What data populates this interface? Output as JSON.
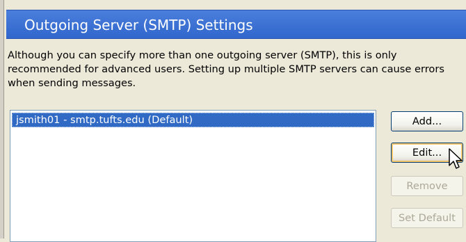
{
  "header": {
    "title": "Outgoing Server (SMTP) Settings"
  },
  "description": "Although you can specify more than one outgoing server (SMTP), this is only recommended for advanced users. Setting up multiple SMTP servers can cause errors when sending messages.",
  "server_list": {
    "items": [
      {
        "label": "jsmith01 - smtp.tufts.edu (Default)",
        "selected": true
      }
    ]
  },
  "buttons": {
    "add": "Add...",
    "edit": "Edit...",
    "remove": "Remove",
    "set_default": "Set Default"
  },
  "colors": {
    "header_bg": "#3a6fd0",
    "selection_bg": "#316ac5",
    "dialog_bg": "#ece9d8",
    "focus_ring": "#f4c66c"
  },
  "cursor": {
    "icon": "pointer-arrow-icon"
  }
}
